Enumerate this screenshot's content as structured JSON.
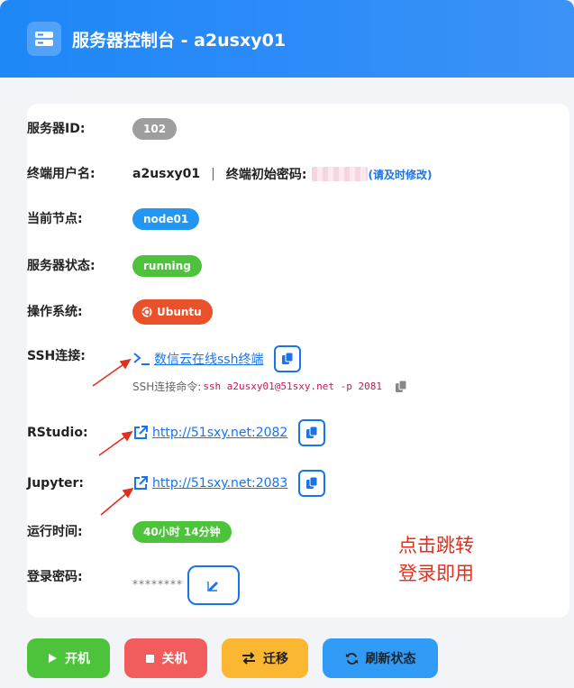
{
  "header": {
    "title": "服务器控制台 - a2usxy01"
  },
  "fields": {
    "server_id": {
      "label": "服务器ID:",
      "value": "102"
    },
    "terminal_user": {
      "label": "终端用户名:",
      "value": "a2usxy01",
      "separator": "|",
      "password_label": "终端初始密码:",
      "password_note": "(请及时修改)"
    },
    "node": {
      "label": "当前节点:",
      "value": "node01"
    },
    "status": {
      "label": "服务器状态:",
      "value": "running"
    },
    "os": {
      "label": "操作系统:",
      "value": "Ubuntu"
    },
    "ssh": {
      "label": "SSH连接:",
      "link_text": "数信云在线ssh终端",
      "cmd_label": "SSH连接命令:",
      "cmd": "ssh a2usxy01@51sxy.net -p 2081"
    },
    "rstudio": {
      "label": "RStudio:",
      "link_text": "http://51sxy.net:2082"
    },
    "jupyter": {
      "label": "Jupyter:",
      "link_text": "http://51sxy.net:2083"
    },
    "uptime": {
      "label": "运行时间:",
      "value": "40小时 14分钟"
    },
    "login_password": {
      "label": "登录密码:",
      "value": "********"
    }
  },
  "annotation": {
    "line1": "点击跳转",
    "line2": "登录即用"
  },
  "actions": {
    "start": "开机",
    "stop": "关机",
    "migrate": "迁移",
    "refresh": "刷新状态"
  },
  "colors": {
    "primary": "#1a73e8",
    "header": "#2f8cf8",
    "green": "#4cc33b",
    "red": "#f25c5c",
    "yellow": "#fbb731",
    "orange": "#e8512a"
  }
}
